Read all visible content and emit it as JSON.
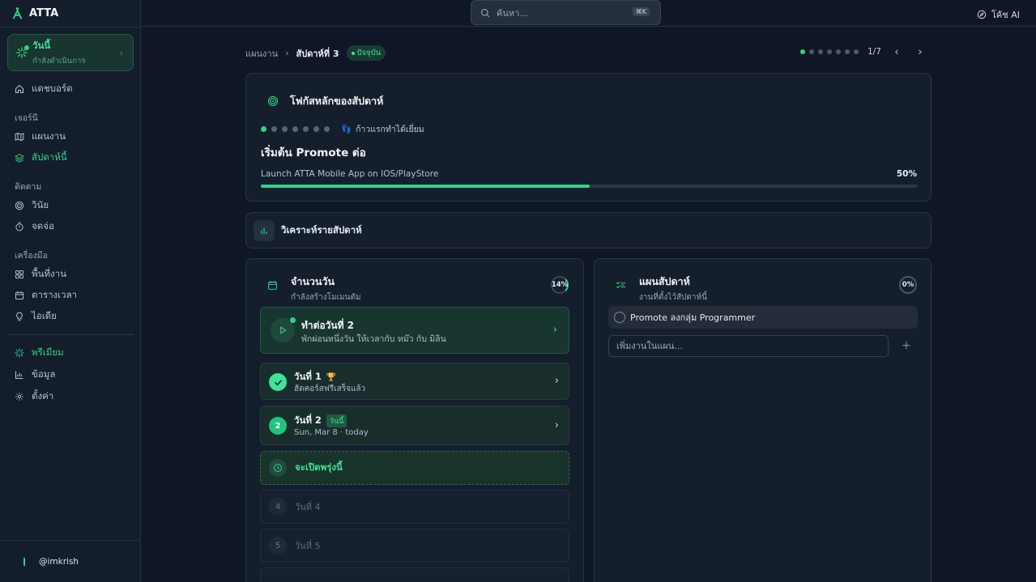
{
  "app": {
    "name": "ATTA"
  },
  "sidebar": {
    "today": {
      "title": "วันนี้",
      "subtitle": "กำลังดำเนินการ"
    },
    "dashboard": "แดชบอร์ด",
    "sections": [
      {
        "title": "เจอร์นี",
        "items": [
          "แผนงาน",
          "สัปดาห์นี้"
        ]
      },
      {
        "title": "ติดตาม",
        "items": [
          "วินัย",
          "จดจ่อ"
        ]
      },
      {
        "title": "เครื่องมือ",
        "items": [
          "พื้นที่งาน",
          "ตารางเวลา",
          "ไอเดีย"
        ]
      }
    ],
    "bottom_items": [
      "พรีเมียม",
      "ข้อมูล",
      "ตั้งค่า"
    ],
    "user": "@imkrish"
  },
  "topbar": {
    "search_placeholder": "ค้นหา...",
    "shortcut": "⌘K",
    "coach_label": "โค้ช AI"
  },
  "breadcrumb": {
    "root": "แผนงาน",
    "current": "สัปดาห์ที่ 3",
    "badge": "ปัจจุบัน"
  },
  "pager": {
    "label": "1/7",
    "total": 7,
    "current": 1
  },
  "focus": {
    "heading": "โฟกัสหลักของสัปดาห์",
    "step_label": "ก้าวแรกทำได้เยี่ยม",
    "steps_total": 7,
    "steps_done": 1,
    "title": "เริ่มต้น Promote ต่อ",
    "goal": "Launch ATTA Mobile App on IOS/PlayStore",
    "progress_label": "50%",
    "progress": 0.5
  },
  "analysis": {
    "label": "วิเคราะห์รายสัปดาห์"
  },
  "days": {
    "title": "จำนวนวัน",
    "subtitle": "กำลังสร้างโมเมนตัม",
    "progress_label": "14%",
    "continue": {
      "title": "ทำต่อวันที่ 2",
      "subtitle": "พักผ่อนหนึ่งวัน ให้เวลากับ หม๊ว กับ มิลิน"
    },
    "day1": {
      "title": "วันที่ 1",
      "subtitle": "ฮัดคอร์สฟรีเสร็จแล้ว"
    },
    "day2": {
      "number": "2",
      "title": "วันที่ 2",
      "tag": "วันนี้",
      "subtitle": "Sun, Mar 8 · today"
    },
    "unlock": "จะเปิดพรุ่งนี้",
    "locked": [
      {
        "n": "4",
        "label": "วันที่ 4"
      },
      {
        "n": "5",
        "label": "วันที่ 5"
      }
    ]
  },
  "plan": {
    "title": "แผนสัปดาห์",
    "subtitle": "งานที่ตั้งไว้สัปดาห์นี้",
    "progress_label": "0%",
    "items": [
      "Promote ลงกลุ่ม Programmer"
    ],
    "input_placeholder": "เพิ่มงานในแผน...",
    "add_symbol": "+"
  }
}
